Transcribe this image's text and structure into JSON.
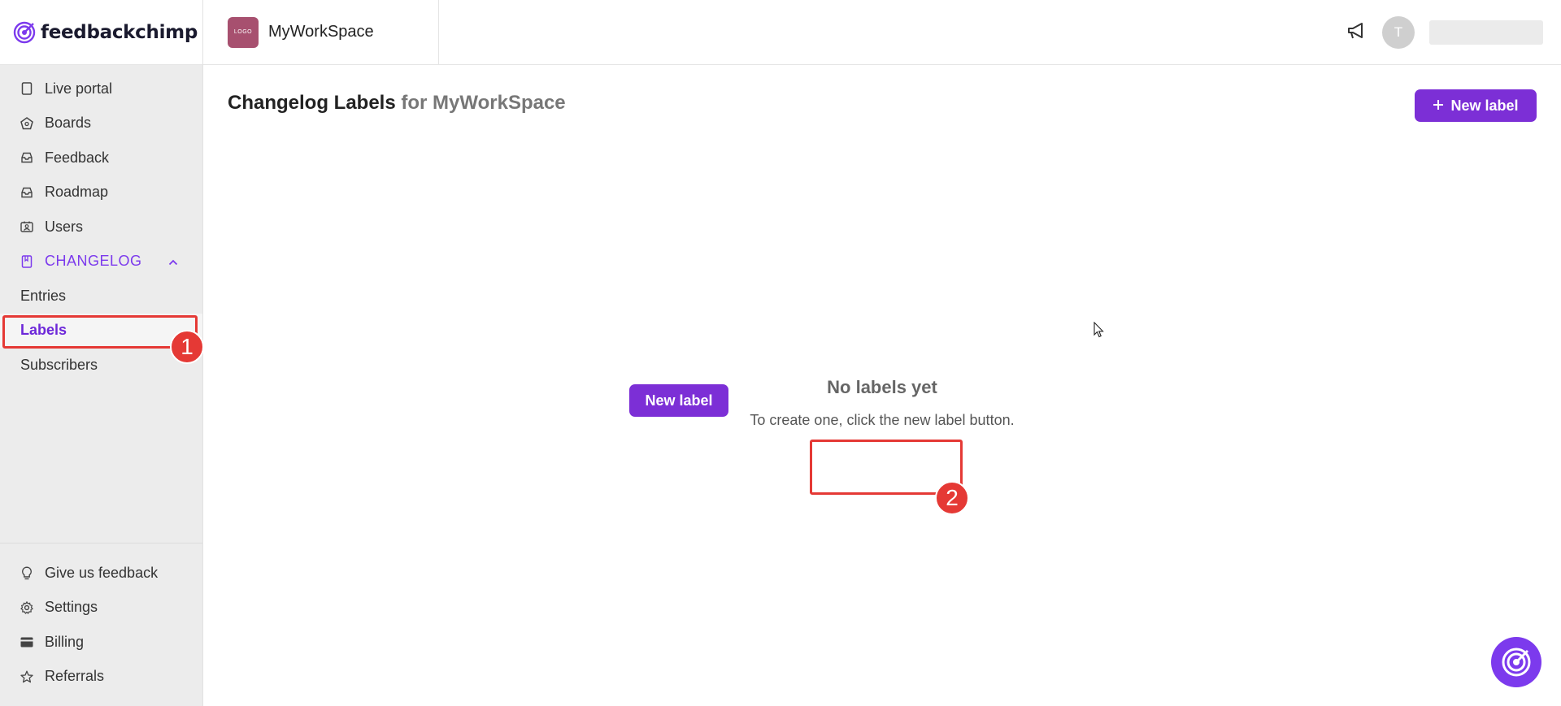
{
  "brand": {
    "name": "feedbackchimp"
  },
  "workspace": {
    "logo_text": "LOGO",
    "name": "MyWorkSpace"
  },
  "user": {
    "avatar_initial": "T"
  },
  "sidebar": {
    "items": [
      {
        "label": "Live portal",
        "icon": "page-icon"
      },
      {
        "label": "Boards",
        "icon": "boards-icon"
      },
      {
        "label": "Feedback",
        "icon": "inbox-icon"
      },
      {
        "label": "Roadmap",
        "icon": "inbox-icon"
      },
      {
        "label": "Users",
        "icon": "users-icon"
      }
    ],
    "section": {
      "label": "CHANGELOG",
      "icon": "book-icon",
      "expanded": true
    },
    "sub_items": [
      {
        "label": "Entries",
        "active": false
      },
      {
        "label": "Labels",
        "active": true
      },
      {
        "label": "Subscribers",
        "active": false
      }
    ],
    "bottom_items": [
      {
        "label": "Give us feedback",
        "icon": "bulb-icon"
      },
      {
        "label": "Settings",
        "icon": "gear-icon"
      },
      {
        "label": "Billing",
        "icon": "card-icon"
      },
      {
        "label": "Referrals",
        "icon": "star-icon"
      }
    ]
  },
  "main": {
    "title": "Changelog Labels",
    "title_suffix": "for MyWorkSpace",
    "new_label_button": "New label",
    "empty_title": "No labels yet",
    "empty_subtitle": "To create one, click the new label button.",
    "empty_button": "New label"
  },
  "annotations": [
    "1",
    "2"
  ],
  "colors": {
    "accent": "#7c2fd6",
    "annotation": "#e53935"
  }
}
